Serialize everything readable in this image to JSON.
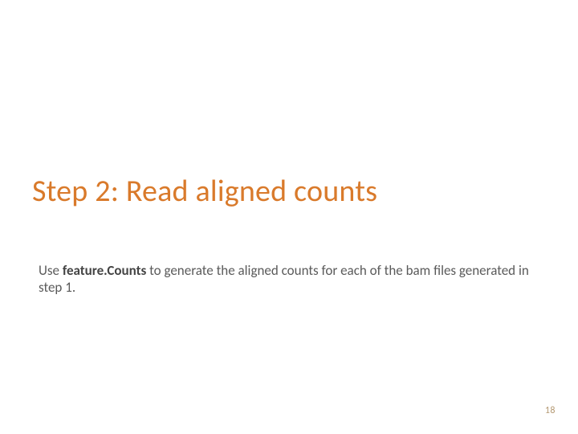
{
  "slide": {
    "title": "Step 2: Read aligned counts",
    "body_pre": "Use ",
    "body_bold": "feature.Counts",
    "body_post": " to generate the aligned counts for each of the bam files generated in step 1.",
    "page_number": "18"
  }
}
